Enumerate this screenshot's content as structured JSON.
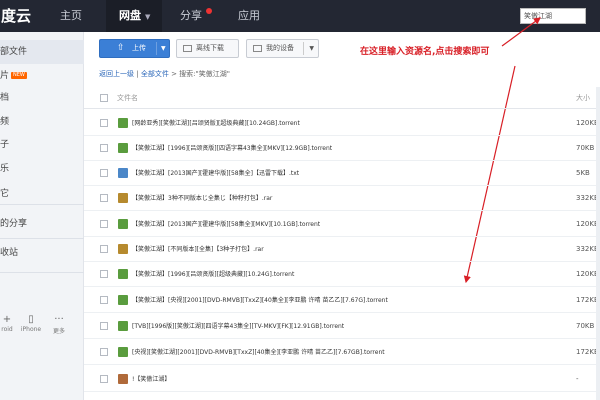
{
  "topbar": {
    "logo": "度云",
    "nav": [
      {
        "label": "主页"
      },
      {
        "label": "网盘"
      },
      {
        "label": "分享"
      },
      {
        "label": "应用"
      }
    ],
    "search_value": "笑傲江湖"
  },
  "sidebar": {
    "items": [
      {
        "label": "部文件"
      },
      {
        "label": "片",
        "badge": "NEW"
      },
      {
        "label": "档"
      },
      {
        "label": "频"
      },
      {
        "label": "子"
      },
      {
        "label": "乐"
      },
      {
        "label": "它"
      },
      {
        "label": "的分享"
      },
      {
        "label": "收站"
      }
    ],
    "devices": [
      {
        "label": "roid",
        "icon": "android-icon"
      },
      {
        "label": "iPhone",
        "icon": "phone-icon"
      },
      {
        "label": "更多",
        "icon": "more-icon"
      }
    ]
  },
  "toolbar": {
    "upload": "上传",
    "offline": "离线下载",
    "device": "我的设备"
  },
  "annotation": "在这里输入资源名,点击搜索即可",
  "breadcrumb": {
    "back": "返回上一级",
    "all": "全部文件",
    "search": "搜索:\"笑傲江湖\""
  },
  "table": {
    "col_name": "文件名",
    "col_size": "大小",
    "rows": [
      {
        "name": "[网龄亚秀][笑傲江湖][吕颂贤版][超级典藏][10.24GB].torrent",
        "size": "120KB",
        "type": "torrent"
      },
      {
        "name": "【笑傲江湖】[1996][吕颂贤版][四语字幕43集全][MKV][12.9GB].torrent",
        "size": "70KB",
        "type": "torrent"
      },
      {
        "name": "【笑傲江湖】[2013国产][霍建华版][58集全]【迅雷下载】.txt",
        "size": "5KB",
        "type": "txt"
      },
      {
        "name": "【笑傲江湖】3种不同版本じ全集じ【种籽打包】.rar",
        "size": "332KB",
        "type": "rar"
      },
      {
        "name": "【笑傲江湖】[2013国产][霍建华版][58集全][MKV][10.1GB].torrent",
        "size": "120KB",
        "type": "torrent"
      },
      {
        "name": "【笑傲江湖】[不同版本][全集]【3种子打包】.rar",
        "size": "332KB",
        "type": "rar"
      },
      {
        "name": "【笑傲江湖】[1996][吕颂贤版][超级典藏][10.24G].torrent",
        "size": "120KB",
        "type": "torrent"
      },
      {
        "name": "【笑傲江湖】[央视][2001][DVD-RMVB][TxxZ][40集全][李亚鹏 许晴 苗乙乙][7.67G].torrent",
        "size": "172KB",
        "type": "torrent"
      },
      {
        "name": "[TVB][1996版][笑傲江湖][四语字幕43集全][TV-MKV][FK][12.91GB].torrent",
        "size": "70KB",
        "type": "torrent"
      },
      {
        "name": "[央视][笑傲江湖][2001][DVD-RMVB][TxxZ][40集全][李亚鹏 许晴 苗乙乙][7.67GB].torrent",
        "size": "172KB",
        "type": "torrent"
      },
      {
        "name": "!【笑傲江湖】",
        "size": "-",
        "type": "folder"
      }
    ]
  },
  "colors": {
    "topbar_bg": "#232733",
    "upload_blue": "#3b7fd6",
    "annotation_red": "#d81f26",
    "link_blue": "#2a66b8"
  }
}
